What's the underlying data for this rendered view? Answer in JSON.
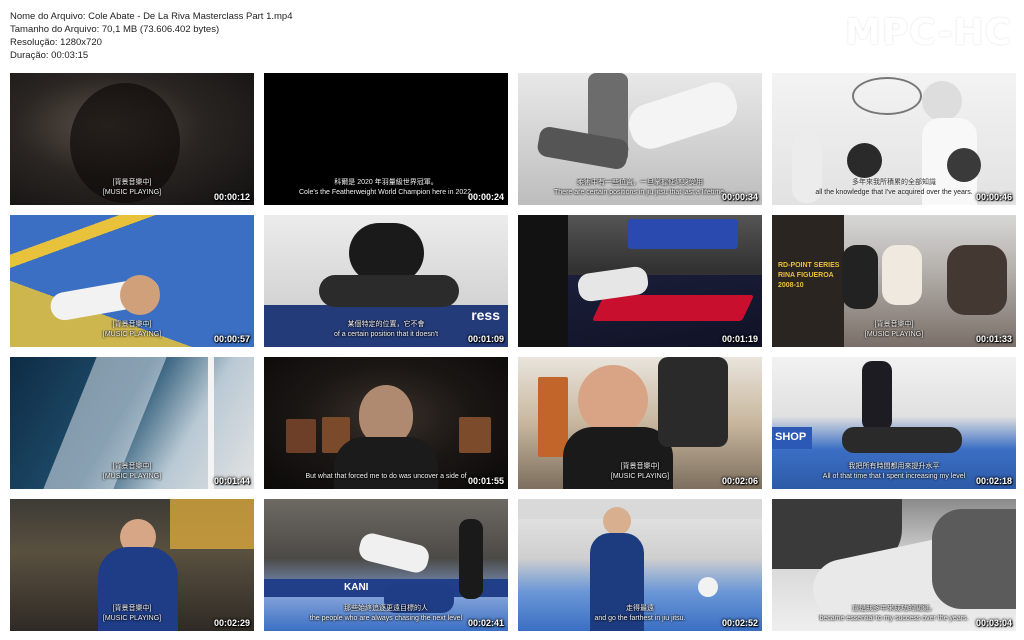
{
  "file_info": {
    "name_line": "Nome do Arquivo: Cole Abate - De La Riva Masterclass Part 1.mp4",
    "size_line": "Tamanho do Arquivo: 70,1 MB (73.606.402 bytes)",
    "resolution_line": "Resolução: 1280x720",
    "duration_line": "Duração: 00:03:15"
  },
  "logo": "MPC-HC",
  "thumbnails": [
    {
      "time": "00:00:12",
      "sub_cn": "[背景音樂中]",
      "sub_en": "[MUSIC PLAYING]"
    },
    {
      "time": "00:00:24",
      "sub_cn": "科爾是 2020 年羽量級世界冠軍。",
      "sub_en": "Cole's the Featherweight World Champion here in 2022."
    },
    {
      "time": "00:00:34",
      "sub_cn": "柔術中有一些位置，一旦掌握便終身受用",
      "sub_en": "There are certain positions in jiu jitsu that last a lifetime."
    },
    {
      "time": "00:00:46",
      "sub_cn": "多年來我所積累的全部知識",
      "sub_en": "all the knowledge that I've acquired over the years."
    },
    {
      "time": "00:00:57",
      "sub_cn": "[背景音樂中]",
      "sub_en": "[MUSIC PLAYING]"
    },
    {
      "time": "00:01:09",
      "sub_cn": "某個特定的位置，它不會",
      "sub_en": "of a certain position that it doesn't"
    },
    {
      "time": "00:01:19",
      "sub_cn": "",
      "sub_en": ""
    },
    {
      "time": "00:01:33",
      "sub_cn": "[背景音樂中]",
      "sub_en": "[MUSIC PLAYING]"
    },
    {
      "time": "00:01:44",
      "sub_cn": "[背景音樂中]",
      "sub_en": "[MUSIC PLAYING]"
    },
    {
      "time": "00:01:55",
      "sub_cn": "",
      "sub_en": "But what that forced me to do was uncover a side of"
    },
    {
      "time": "00:02:06",
      "sub_cn": "[背景音樂中]",
      "sub_en": "[MUSIC PLAYING]"
    },
    {
      "time": "00:02:18",
      "sub_cn": "我把所有時間都用來提升水平",
      "sub_en": "All of that time that I spent increasing my level"
    },
    {
      "time": "00:02:29",
      "sub_cn": "[背景音樂中]",
      "sub_en": "[MUSIC PLAYING]"
    },
    {
      "time": "00:02:41",
      "sub_cn": "那些始終追逐更遠目標的人",
      "sub_en": "the people who are always chasing the next level"
    },
    {
      "time": "00:02:52",
      "sub_cn": "走得最遠",
      "sub_en": "and go the farthest in jiu jitsu."
    },
    {
      "time": "00:03:04",
      "sub_cn": "這是我多年來成功的關鍵。",
      "sub_en": "became essential to my success over the years."
    }
  ],
  "colors": {
    "mat_blue": "#3b6fc4",
    "mat_yellow": "#e8c23a",
    "background": "#ffffff"
  }
}
